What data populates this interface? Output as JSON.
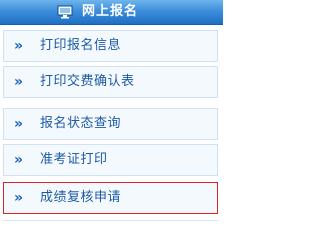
{
  "header": {
    "title": "网上报名",
    "icon": "monitor-icon"
  },
  "menu": {
    "items": [
      {
        "chevron": "»",
        "label": "打印报名信息"
      },
      {
        "chevron": "»",
        "label": "打印交费确认表"
      },
      {
        "chevron": "»",
        "label": "报名状态查询"
      },
      {
        "chevron": "»",
        "label": "准考证打印"
      },
      {
        "chevron": "»",
        "label": "成绩复核申请",
        "active": true
      }
    ]
  },
  "colors": {
    "header_bg": "#3d8edb",
    "item_bg": "#f4f9fd",
    "item_border": "#cfe2f3",
    "active_border": "#d9242b",
    "link_text": "#1d5aa5"
  }
}
